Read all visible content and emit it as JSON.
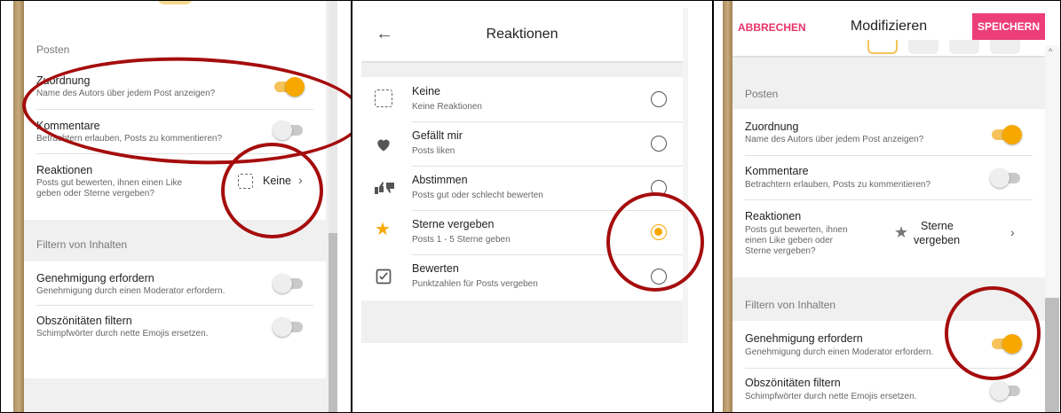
{
  "panel1": {
    "section_posts": "Posten",
    "attribution": {
      "title": "Zuordnung",
      "subtitle": "Name des Autors über jedem Post anzeigen?",
      "enabled": true
    },
    "comments": {
      "title": "Kommentare",
      "subtitle": "Betrachtern erlauben, Posts zu kommentieren?",
      "enabled": false
    },
    "reactions": {
      "title": "Reaktionen",
      "subtitle_line1": "Posts gut bewerten, ihnen einen Like",
      "subtitle_line2": "geben oder Sterne vergeben?",
      "value": "Keine",
      "icon": "dashed-square-icon"
    },
    "section_filter": "Filtern von Inhalten",
    "approval": {
      "title": "Genehmigung erfordern",
      "subtitle": "Genehmigung durch einen Moderator erfordern.",
      "enabled": false
    },
    "profanity": {
      "title": "Obszönitäten filtern",
      "subtitle": "Schimpfwörter durch nette Emojis ersetzen.",
      "enabled": false
    }
  },
  "panel2": {
    "title": "Reaktionen",
    "back_icon": "arrow-left-icon",
    "options": [
      {
        "title": "Keine",
        "subtitle": "Keine Reaktionen",
        "icon": "dashed-square-icon",
        "selected": false
      },
      {
        "title": "Gefällt mir",
        "subtitle": "Posts liken",
        "icon": "heart-icon",
        "selected": false
      },
      {
        "title": "Abstimmen",
        "subtitle": "Posts gut oder schlecht bewerten",
        "icon": "thumbs-icon",
        "selected": false
      },
      {
        "title": "Sterne vergeben",
        "subtitle": "Posts 1 - 5 Sterne geben",
        "icon": "star-icon",
        "selected": true
      },
      {
        "title": "Bewerten",
        "subtitle": "Punktzahlen für Posts vergeben",
        "icon": "check-square-icon",
        "selected": false
      }
    ]
  },
  "panel3": {
    "cancel": "ABBRECHEN",
    "title": "Modifizieren",
    "save": "SPEICHERN",
    "section_posts": "Posten",
    "attribution": {
      "title": "Zuordnung",
      "subtitle": "Name des Autors über jedem Post anzeigen?",
      "enabled": true
    },
    "comments": {
      "title": "Kommentare",
      "subtitle": "Betrachtern erlauben, Posts zu kommentieren?",
      "enabled": false
    },
    "reactions": {
      "title": "Reaktionen",
      "subtitle_line1": "Posts gut bewerten, ihnen",
      "subtitle_line2": "einen Like geben oder",
      "subtitle_line3": "Sterne vergeben?",
      "value_line1": "Sterne",
      "value_line2": "vergeben",
      "icon": "star-icon"
    },
    "section_filter": "Filtern von Inhalten",
    "approval": {
      "title": "Genehmigung erfordern",
      "subtitle": "Genehmigung durch einen Moderator erfordern.",
      "enabled": true
    },
    "profanity": {
      "title": "Obszönitäten filtern",
      "subtitle": "Schimpfwörter durch nette Emojis ersetzen.",
      "enabled": false
    }
  },
  "colors": {
    "accent": "#f7a800",
    "highlight_ring": "#a50d0d",
    "save_button": "#ec3e78",
    "cancel_text": "#e8336b"
  }
}
